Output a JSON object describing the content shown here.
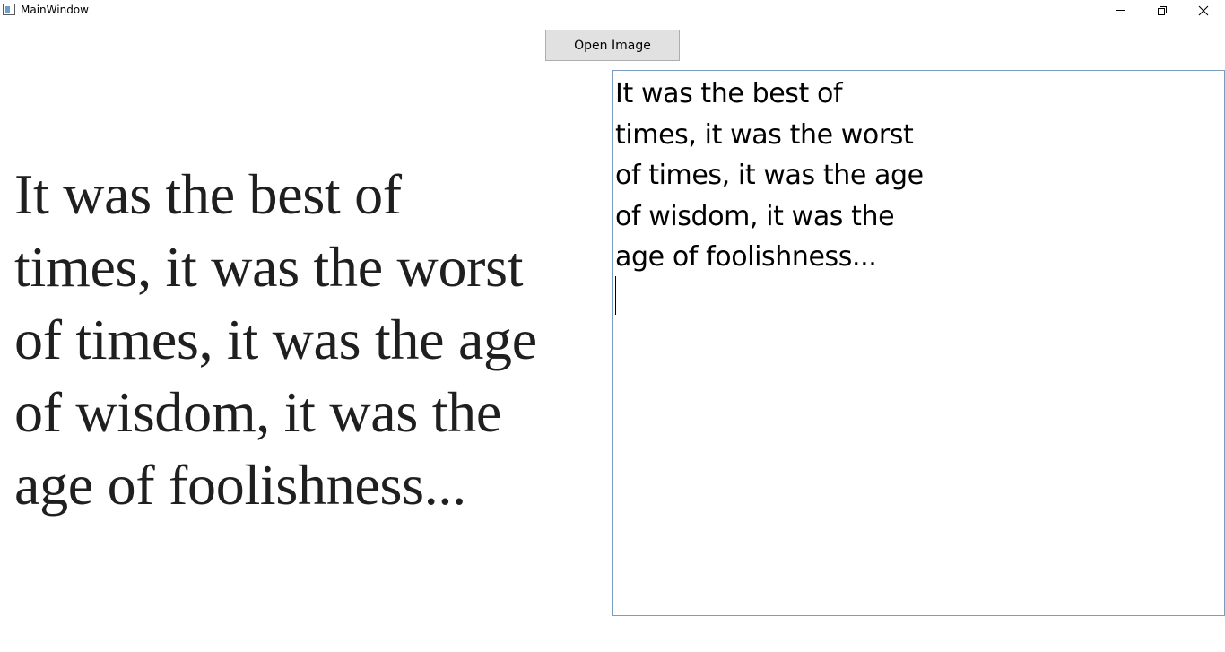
{
  "window": {
    "title": "MainWindow",
    "icons": {
      "app": "window-app-icon",
      "minimize": "minimize-icon",
      "maximize": "restore-icon",
      "close": "close-icon"
    },
    "close_glyph": "✕"
  },
  "toolbar": {
    "open_image_label": "Open Image"
  },
  "image_text": "It was the best of\ntimes, it was the worst\nof times, it was the age\nof wisdom, it was the\nage of foolishness...",
  "ocr_result": "It was the best of\ntimes, it was the worst\nof times, it was the age\nof wisdom, it was the\nage of foolishness..."
}
